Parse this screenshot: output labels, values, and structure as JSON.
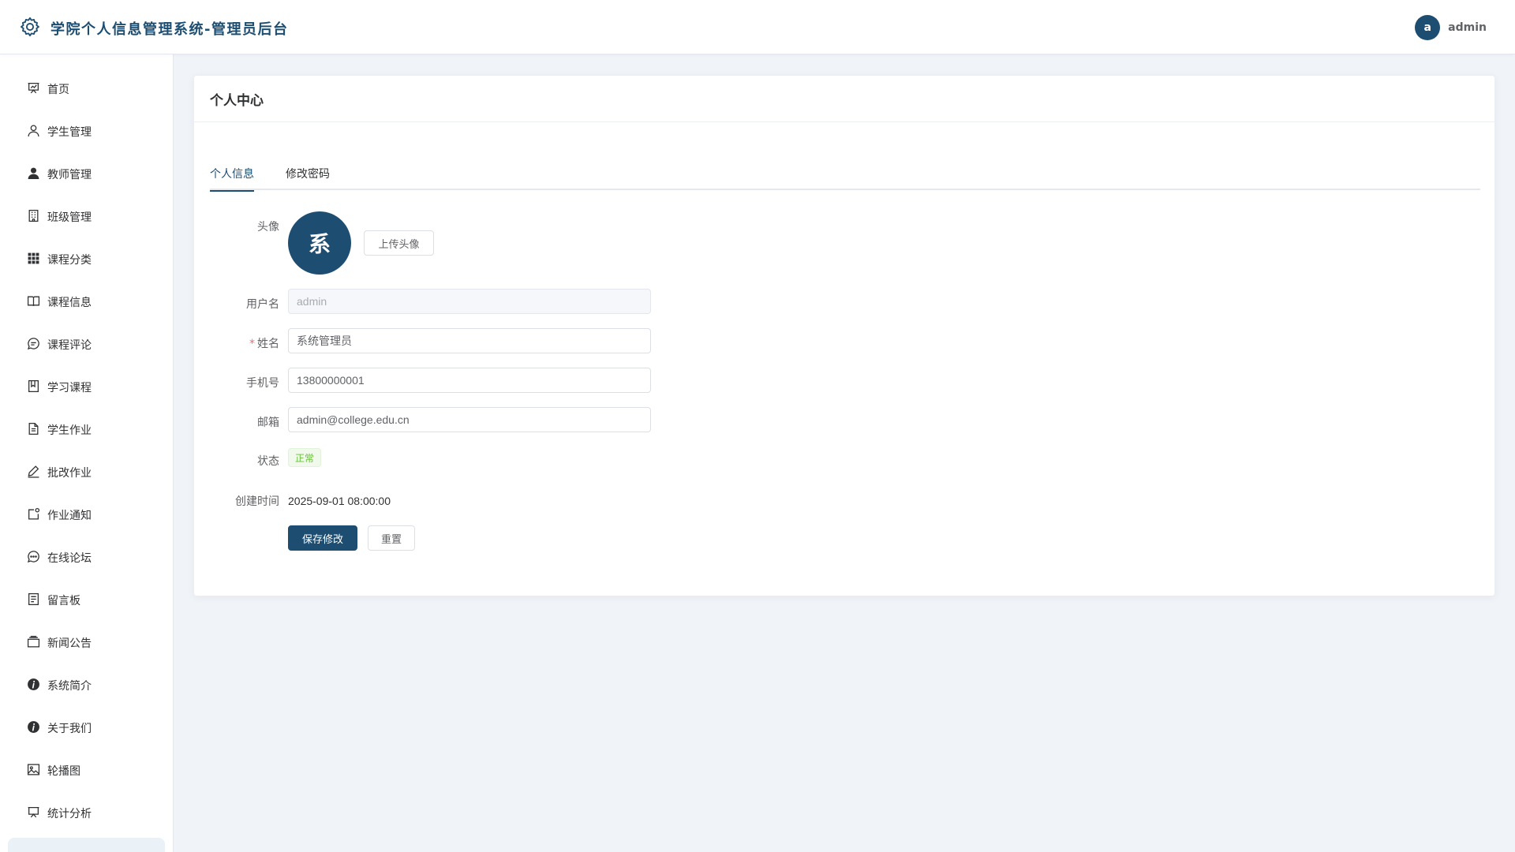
{
  "header": {
    "title": "学院个人信息管理系统-管理员后台",
    "logo_icon": "gear-icon",
    "user": {
      "avatar_letter": "a",
      "name": "admin"
    }
  },
  "sidebar": {
    "items": [
      {
        "label": "首页",
        "icon": "dashboard-icon"
      },
      {
        "label": "学生管理",
        "icon": "user-icon"
      },
      {
        "label": "教师管理",
        "icon": "user-filled-icon"
      },
      {
        "label": "班级管理",
        "icon": "building-icon"
      },
      {
        "label": "课程分类",
        "icon": "grid-icon"
      },
      {
        "label": "课程信息",
        "icon": "book-icon"
      },
      {
        "label": "课程评论",
        "icon": "comment-icon"
      },
      {
        "label": "学习课程",
        "icon": "notebook-icon"
      },
      {
        "label": "学生作业",
        "icon": "document-icon"
      },
      {
        "label": "批改作业",
        "icon": "edit-pen-icon"
      },
      {
        "label": "作业通知",
        "icon": "notification-icon"
      },
      {
        "label": "在线论坛",
        "icon": "chat-dot-icon"
      },
      {
        "label": "留言板",
        "icon": "tickets-icon"
      },
      {
        "label": "新闻公告",
        "icon": "news-icon"
      },
      {
        "label": "系统简介",
        "icon": "info-filled-icon"
      },
      {
        "label": "关于我们",
        "icon": "info-filled-icon"
      },
      {
        "label": "轮播图",
        "icon": "picture-icon"
      },
      {
        "label": "统计分析",
        "icon": "data-board-icon"
      }
    ]
  },
  "card": {
    "title": "个人中心",
    "tabs": [
      {
        "label": "个人信息",
        "active": true
      },
      {
        "label": "修改密码",
        "active": false
      }
    ]
  },
  "form": {
    "avatar_label": "头像",
    "avatar_text": "系",
    "upload_button": "上传头像",
    "username_label": "用户名",
    "username_value": "admin",
    "name_required_mark": "*",
    "name_label": "姓名",
    "name_value": "系统管理员",
    "phone_label": "手机号",
    "phone_value": "13800000001",
    "email_label": "邮箱",
    "email_value": "admin@college.edu.cn",
    "status_label": "状态",
    "status_value": "正常",
    "created_label": "创建时间",
    "created_value": "2025-09-01 08:00:00",
    "save_button": "保存修改",
    "reset_button": "重置"
  },
  "colors": {
    "primary": "#1d4e72",
    "success": "#67c23a",
    "required": "#f56c6c",
    "background": "#f0f4f8"
  }
}
